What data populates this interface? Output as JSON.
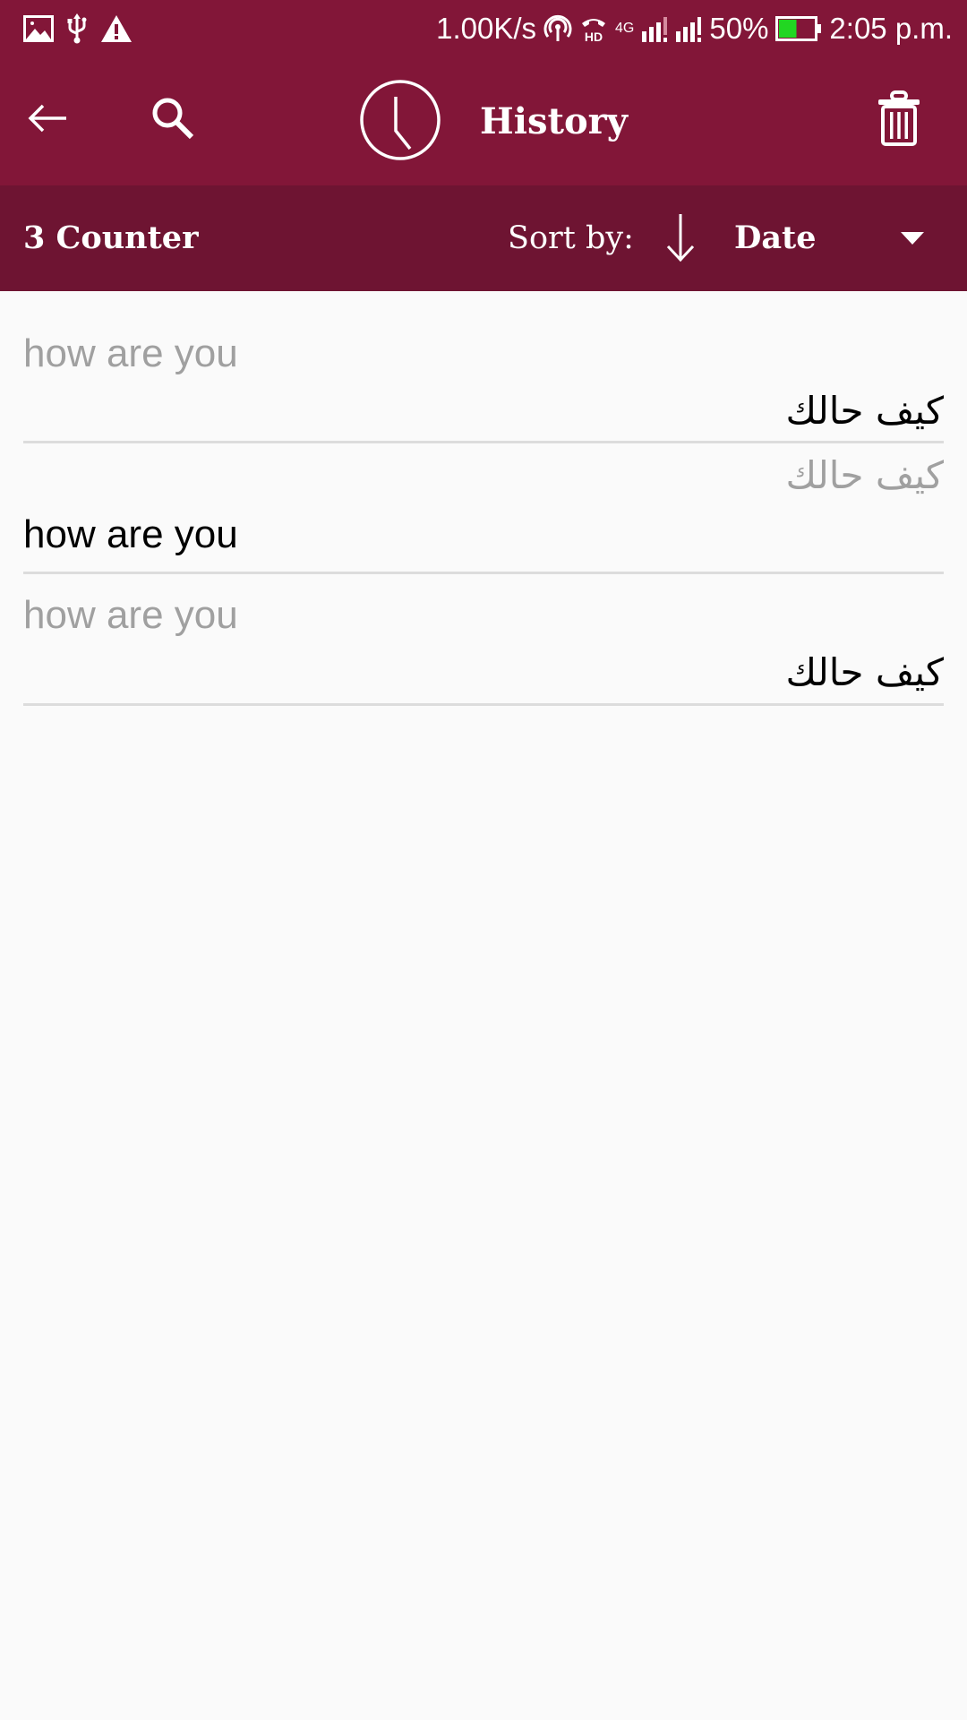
{
  "status_bar": {
    "left_icons": [
      "image-icon",
      "usb-icon",
      "warning-icon"
    ],
    "network_speed": "1.00K/s",
    "hotspot_icon": "hotspot-icon",
    "hd_call_icon": "hd-voice-icon",
    "network_type": "4G",
    "sim1_signal": "signal-icon",
    "sim2_signal": "signal-icon",
    "battery_percent": "50%",
    "battery_level": 0.5,
    "battery_color": "#22d622",
    "time": "2:05 p.m."
  },
  "app_bar": {
    "back_icon": "arrow-left-icon",
    "search_icon": "search-icon",
    "title_icon": "clock-icon",
    "title": "History",
    "delete_icon": "trash-icon",
    "color": "#821638"
  },
  "sub_bar": {
    "counter": "3 Counter",
    "sort_label": "Sort by:",
    "sort_direction_icon": "arrow-down-icon",
    "sort_direction": "descending",
    "sort_value": "Date",
    "color": "#6e1432"
  },
  "history": [
    {
      "source": "how are you",
      "translation": "كيف حالك",
      "highlight": "translation"
    },
    {
      "source": "كيف حالك",
      "translation": "how are you",
      "highlight": "translation"
    },
    {
      "source": "how are you",
      "translation": "كيف حالك",
      "highlight": "translation"
    }
  ]
}
